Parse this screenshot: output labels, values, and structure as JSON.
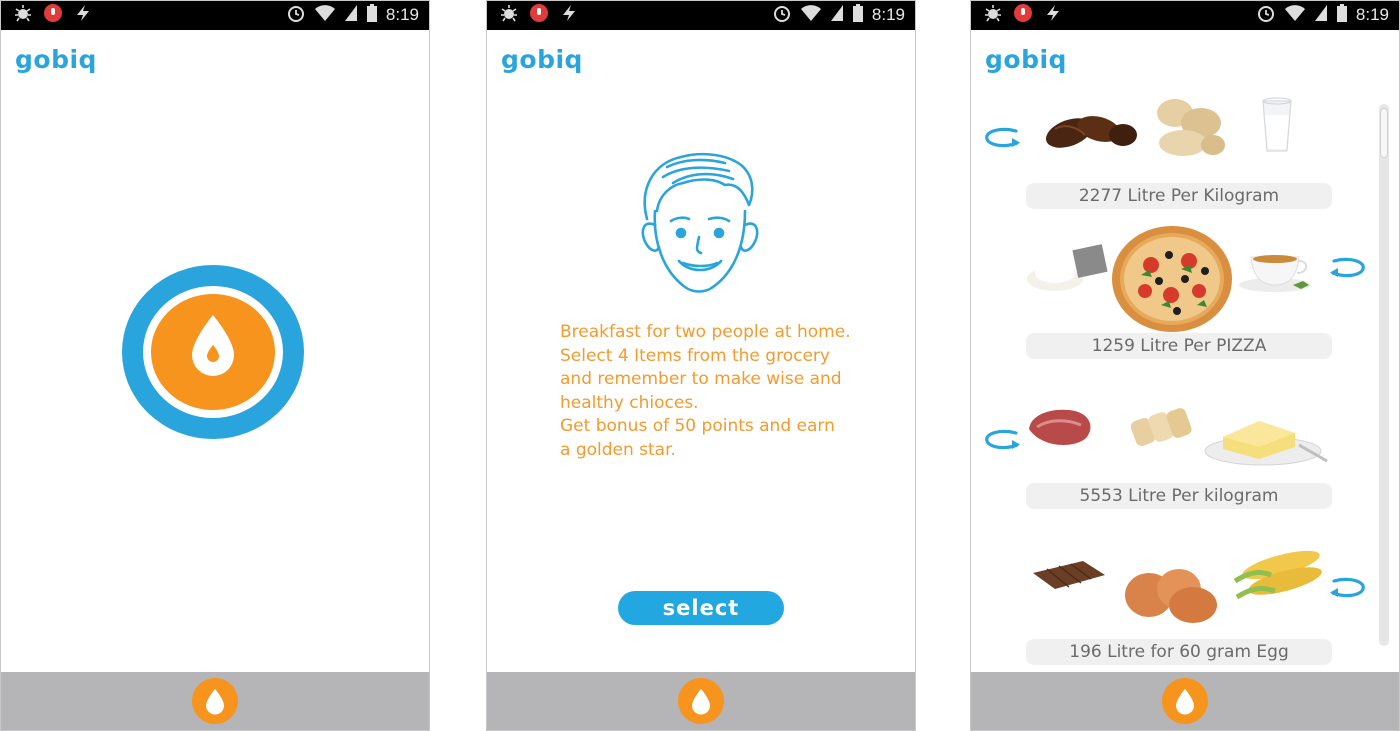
{
  "status_bar": {
    "time": "8:19",
    "left_icons": [
      "bug-icon",
      "record-icon",
      "flash-icon"
    ],
    "right_icons": [
      "alarm-icon",
      "wifi-icon",
      "signal-icon",
      "battery-icon"
    ]
  },
  "brand": {
    "name": "gobiq",
    "color": "#2aa4dc"
  },
  "colors": {
    "accent_orange": "#f7941d",
    "accent_blue": "#22a7e0",
    "text_orange": "#f39b2e",
    "bottom_bar": "#b5b5b7"
  },
  "screens": [
    {
      "id": "splash",
      "logo": "water-drop-logo",
      "home_icon": "water-drop-icon"
    },
    {
      "id": "briefing",
      "avatar": "boy-face-avatar",
      "instruction_lines": [
        "Breakfast for two people at home.",
        "Select 4 Items from the grocery",
        "and remember to make wise and",
        "healthy chioces.",
        "Get bonus of 50 points and earn",
        "a golden star."
      ],
      "select_button": "select",
      "home_icon": "water-drop-icon"
    },
    {
      "id": "foods",
      "groups": [
        {
          "items": [
            "dates",
            "peanuts",
            "milk"
          ],
          "label": "2277 Litre Per Kilogram",
          "rotate_side": "left"
        },
        {
          "items": [
            "flour",
            "pizza",
            "tea"
          ],
          "label": "1259 Litre Per PIZZA",
          "rotate_side": "right"
        },
        {
          "items": [
            "beef",
            "bread",
            "butter"
          ],
          "label": "5553 Litre Per kilogram",
          "rotate_side": "left"
        },
        {
          "items": [
            "chocolate",
            "eggs",
            "corn"
          ],
          "label": "196 Litre for 60 gram Egg",
          "rotate_side": "right"
        }
      ],
      "home_icon": "water-drop-icon"
    }
  ]
}
